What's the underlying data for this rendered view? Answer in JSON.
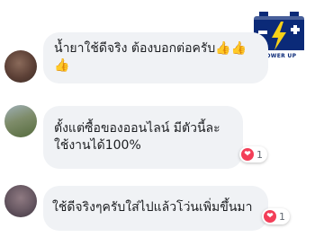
{
  "comments": [
    {
      "text": "น้ำยาใช้ดีจริง ต้องบอกต่อครับ👍👍👍"
    },
    {
      "text": "ตั้งแต่ซื้อของออนไลน์ มีตัวนี้ละใช้งานได้100%",
      "reaction_count": "1"
    },
    {
      "text": "ใช้ดีจริงๆครับใส่ไปแล้วโว่นเพิ่มขึ้นมา",
      "reaction_count": "1"
    }
  ],
  "logo": {
    "text": "POWER UP"
  },
  "colors": {
    "heart": "#f33e58",
    "bubble": "#f0f2f5",
    "logo_blue": "#0b2a78"
  }
}
